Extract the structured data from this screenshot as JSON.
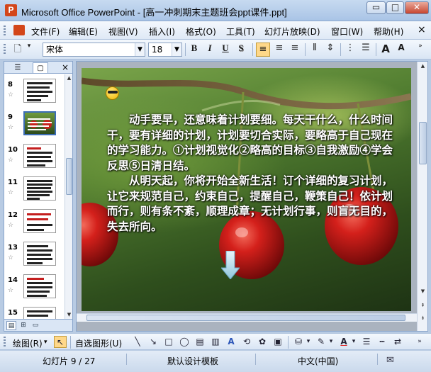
{
  "window": {
    "title": "Microsoft Office PowerPoint - [高一冲刺期末主题班会ppt课件.ppt]",
    "minimize_glyph": "▭",
    "maximize_glyph": "□",
    "close_glyph": "✕",
    "app_icon_letter": "P"
  },
  "menu": {
    "items": [
      {
        "label": "文件(F)"
      },
      {
        "label": "编辑(E)"
      },
      {
        "label": "视图(V)"
      },
      {
        "label": "插入(I)"
      },
      {
        "label": "格式(O)"
      },
      {
        "label": "工具(T)"
      },
      {
        "label": "幻灯片放映(D)"
      },
      {
        "label": "窗口(W)"
      },
      {
        "label": "帮助(H)"
      }
    ],
    "close_glyph": "×"
  },
  "toolbar": {
    "font_name": "宋体",
    "font_size": "18",
    "bold": "B",
    "italic": "I",
    "underline": "U",
    "shadow": "S",
    "grow_font": "A",
    "shrink_font": "A"
  },
  "slides_panel": {
    "close_glyph": "×",
    "thumbnails": [
      {
        "number": "8"
      },
      {
        "number": "9",
        "selected": true
      },
      {
        "number": "10"
      },
      {
        "number": "11"
      },
      {
        "number": "12"
      },
      {
        "number": "13"
      },
      {
        "number": "14"
      },
      {
        "number": "15"
      }
    ]
  },
  "slide": {
    "paragraph1": "动手要早，还意味着计划要细。每天干什么，什么时间干，要有详细的计划，计划要切合实际，要略高于自己现在的学习能力。①计划视觉化②略高的目标③自我激励④学会反思⑤日清日结。",
    "paragraph2": "从明天起，你将开始全新生活！订个详细的复习计划，让它来规范自己，约束自己，提醒自己，鞭策自己！依计划而行，则有条不紊，顺理成章；无计划行事，则盲无目的，失去所向。"
  },
  "drawing_toolbar": {
    "draw_label": "绘图(R)",
    "autoshapes_label": "自选图形(U)"
  },
  "status": {
    "slide_info": "幻灯片 9 / 27",
    "design": "默认设计模板",
    "language": "中文(中国)"
  }
}
